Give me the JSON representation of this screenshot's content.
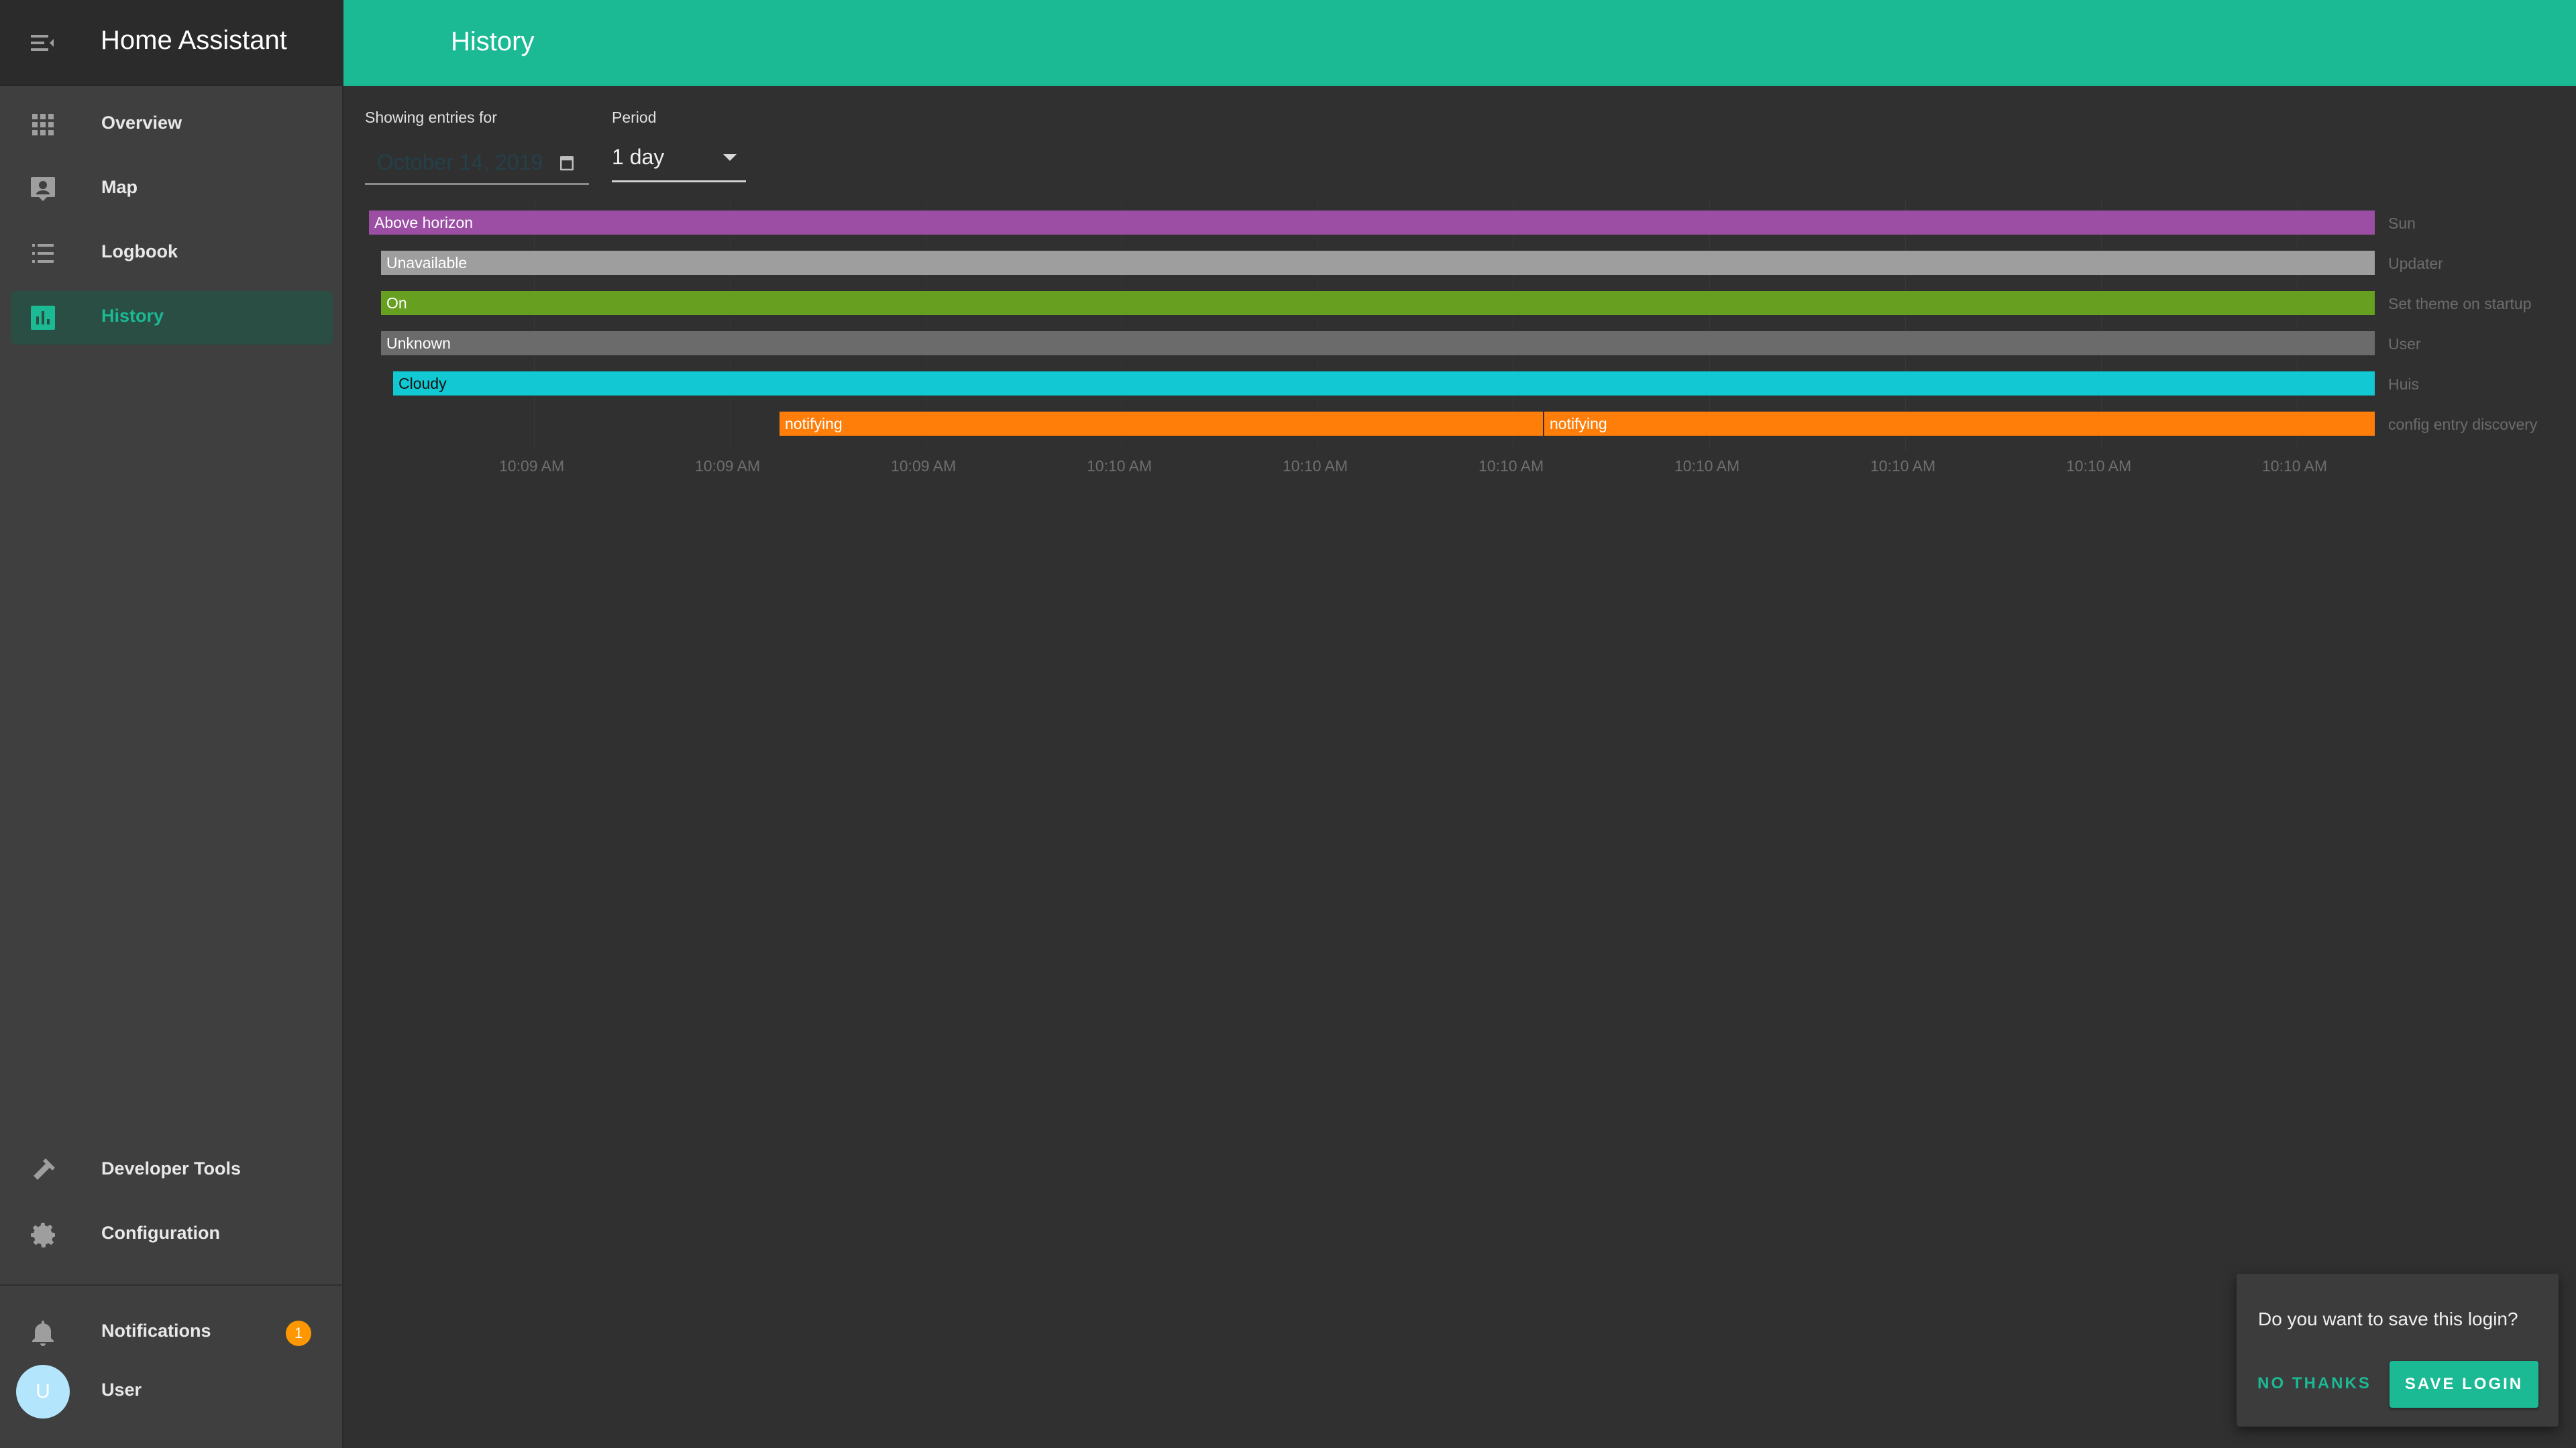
{
  "app": {
    "title": "Home Assistant"
  },
  "sidebar": {
    "items": [
      {
        "label": "Overview",
        "icon": "apps-icon"
      },
      {
        "label": "Map",
        "icon": "map-account-icon"
      },
      {
        "label": "Logbook",
        "icon": "format-list-bulleted-icon"
      },
      {
        "label": "History",
        "icon": "chart-box-icon",
        "active": true
      },
      {
        "label": "Developer Tools",
        "icon": "hammer-icon"
      },
      {
        "label": "Configuration",
        "icon": "gear-icon"
      },
      {
        "label": "Notifications",
        "icon": "bell-icon",
        "badge": "1"
      },
      {
        "label": "User",
        "icon": "avatar",
        "avatar_letter": "U"
      }
    ]
  },
  "header": {
    "title": "History"
  },
  "filters": {
    "date_label": "Showing entries for",
    "date_value": "October 14, 2019",
    "period_label": "Period",
    "period_value": "1 day"
  },
  "timeline": {
    "rows": [
      {
        "entity": "Sun",
        "segments": [
          {
            "state": "Above horizon",
            "color": "#9b4ea4"
          }
        ]
      },
      {
        "entity": "Updater",
        "segments": [
          {
            "state": "Unavailable",
            "color": "#9e9e9e"
          }
        ]
      },
      {
        "entity": "Set theme on startup",
        "segments": [
          {
            "state": "On",
            "color": "#67a021"
          }
        ]
      },
      {
        "entity": "User",
        "segments": [
          {
            "state": "Unknown",
            "color": "#6b6b6b"
          }
        ]
      },
      {
        "entity": "Huis",
        "segments": [
          {
            "state": "Cloudy",
            "color": "#11c8d3"
          }
        ]
      },
      {
        "entity": "config entry discovery",
        "segments": [
          {
            "state": "notifying",
            "color": "#ff7e0a"
          },
          {
            "state": "notifying",
            "color": "#ff7e0a"
          }
        ]
      }
    ],
    "ticks": [
      "10:09 AM",
      "10:09 AM",
      "10:09 AM",
      "10:10 AM",
      "10:10 AM",
      "10:10 AM",
      "10:10 AM",
      "10:10 AM",
      "10:10 AM",
      "10:10 AM"
    ]
  },
  "toast": {
    "message": "Do you want to save this login?",
    "dismiss_label": "NO THANKS",
    "confirm_label": "SAVE LOGIN"
  },
  "colors": {
    "accent": "#1bb994",
    "badge": "#ff9800"
  }
}
